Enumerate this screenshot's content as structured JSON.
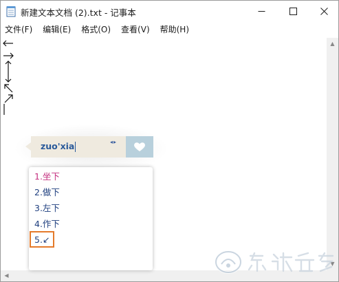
{
  "window": {
    "title": "新建文本文档 (2).txt - 记事本",
    "icon": "notepad-icon",
    "buttons": {
      "minimize": "minimize-icon",
      "maximize": "maximize-icon",
      "close": "close-icon"
    }
  },
  "menu": {
    "items": [
      {
        "label": "文件(F)"
      },
      {
        "label": "编辑(E)"
      },
      {
        "label": "格式(O)"
      },
      {
        "label": "查看(V)"
      },
      {
        "label": "帮助(H)"
      }
    ]
  },
  "editor": {
    "content_symbols": [
      "←",
      "→",
      "↕",
      "↖",
      "↗",
      "|"
    ]
  },
  "ime": {
    "composition": "zuo'xia",
    "page_arrows": "◂▸",
    "skin_icon": "heart-icon",
    "candidates": [
      {
        "label": "1.坐下"
      },
      {
        "label": "2.做下"
      },
      {
        "label": "3.左下"
      },
      {
        "label": "4.作下"
      },
      {
        "label": "5.↙"
      }
    ],
    "colors": {
      "bar_bg": "#efeadf",
      "skin_bg": "#b8d0dc",
      "first_candidate": "#c42f7f",
      "candidate": "#1f3f7f",
      "highlight": "#e47a2a"
    }
  },
  "watermark": {
    "text": "系统之家"
  }
}
